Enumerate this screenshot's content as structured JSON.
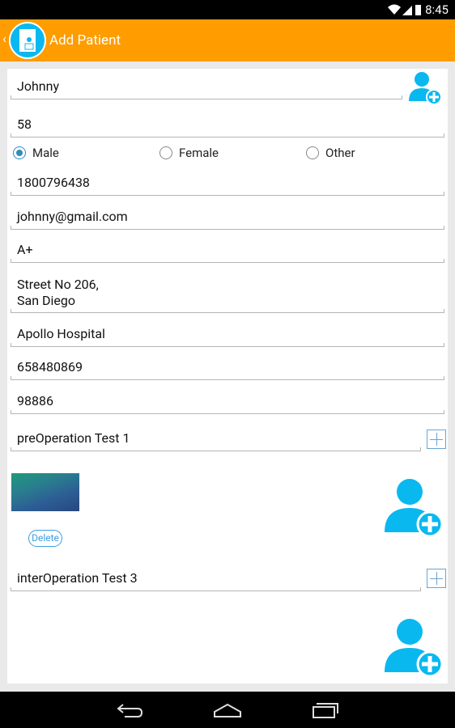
{
  "status_bar": {
    "time": "8:45",
    "icons": [
      "wifi-icon",
      "signal-icon",
      "battery-icon"
    ]
  },
  "app_bar": {
    "title": "Add Patient",
    "back_icon": "chevron-left-icon",
    "logo": "patient-record-icon"
  },
  "form": {
    "name": "Johnny",
    "age": "58",
    "gender": {
      "options": [
        "Male",
        "Female",
        "Other"
      ],
      "selected": "Male"
    },
    "phone": "1800796438",
    "email": "johnny@gmail.com",
    "blood_group": "A+",
    "address_line1": "Street No 206,",
    "address_line2": "San Diego",
    "hospital": "Apollo Hospital",
    "number1": "658480869",
    "number2": "98886",
    "pre_operation": "preOperation Test 1",
    "delete_label": "Delete",
    "inter_operation": "interOperation Test 3"
  },
  "colors": {
    "accent": "#ff9c00",
    "icon_blue": "#0ab8f0"
  }
}
